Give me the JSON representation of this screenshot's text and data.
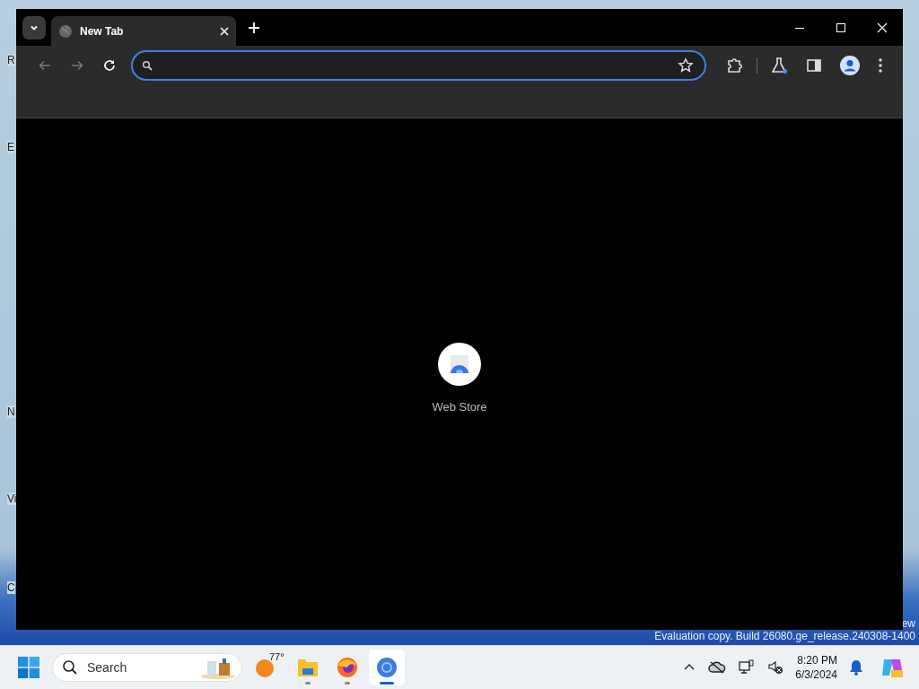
{
  "desktop": {
    "icon_labels": [
      {
        "text": "R"
      },
      {
        "text": "E"
      },
      {
        "text": "N"
      },
      {
        "text": "Vi"
      },
      {
        "text": "C"
      }
    ],
    "watermark": [
      "ew",
      "Evaluation copy. Build 26080.ge_release.240308-1400"
    ]
  },
  "browser": {
    "tabs": [
      {
        "title": "New Tab",
        "selected": true
      }
    ],
    "address_bar": {
      "focused": true
    },
    "shortcuts": [
      {
        "label": "Web Store"
      }
    ]
  },
  "taskbar": {
    "search": {
      "placeholder": "Search"
    },
    "weather": {
      "temperature": "77°"
    },
    "apps": [
      {
        "kind": "files",
        "active": false
      },
      {
        "kind": "firefox",
        "active": false
      },
      {
        "kind": "chrome",
        "active": true
      }
    ],
    "clock": {
      "time": "8:20 PM",
      "date": "6/3/2024"
    }
  }
}
